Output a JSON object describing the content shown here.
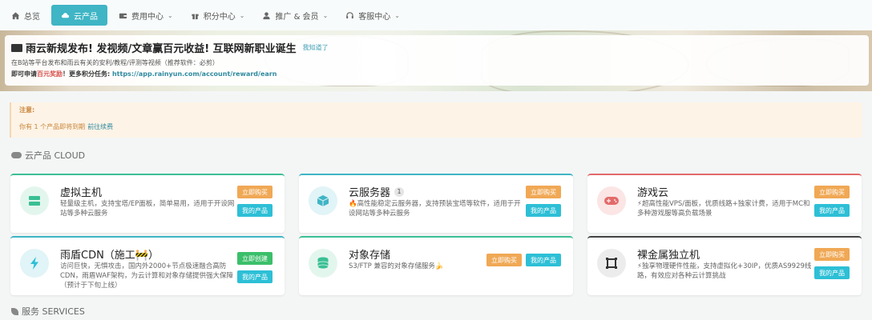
{
  "nav": {
    "items": [
      {
        "label": "总览",
        "icon": "home-icon"
      },
      {
        "label": "云产品",
        "icon": "cloud-icon"
      },
      {
        "label": "费用中心",
        "icon": "wallet-icon"
      },
      {
        "label": "积分中心",
        "icon": "gift-icon"
      },
      {
        "label": "推广 & 会员",
        "icon": "user-icon"
      },
      {
        "label": "客服中心",
        "icon": "headset-icon"
      }
    ],
    "active_color": "#3fb5c5"
  },
  "notice": {
    "title": "雨云新规发布! 发视频/文章赢百元收益! 互联网新职业诞生",
    "know_link": "我知道了",
    "line1": "在B站等平台发布和雨云有关的安利/教程/评测等视频（推荐软件：必剪）",
    "line2_prefix": "即可申请",
    "line2_red": "百元奖励",
    "line2_mid": "！更多积分任务: ",
    "line2_link": "https://app.rainyun.com/account/reward/earn"
  },
  "alert": {
    "title": "注意:",
    "body": "你有 1 个产品即将到期",
    "link": "前往续费"
  },
  "sections": {
    "cloud": "云产品 CLOUD",
    "services": "服务 SERVICES"
  },
  "products": [
    {
      "title": "虚拟主机",
      "desc": "轻量级主机，支持宝塔/EP面板，简单易用，适用于开设网站等多种云服务",
      "btn1": "立即购买",
      "btn2": "我的产品",
      "icon": "server-icon",
      "color": "#3bbf94"
    },
    {
      "title": "云服务器",
      "badge": "1",
      "desc": "🔥高性能稳定云服务器，支持预装宝塔等软件，适用于开设网站等多种云服务",
      "btn1": "立即购买",
      "btn2": "我的产品",
      "icon": "box-icon",
      "color": "#3fb5c5"
    },
    {
      "title": "游戏云",
      "desc": "⚡超高性能VPS/面板，优质线路+独家计费，适用于MC和多种游戏服等高负载场景",
      "btn1": "立即购买",
      "btn2": "我的产品",
      "icon": "gamepad-icon",
      "color": "#e36a6a"
    },
    {
      "title": "雨盾CDN（施工🚧）",
      "desc": "访问巨快，无惧攻击，国内外2000+节点极速融合高防CDN，雨盾WAF架构，为云计算和对象存储提供强大保障（预计于下旬上线）",
      "btn1": "立即创建",
      "btn2": "我的产品",
      "icon": "bolt-icon",
      "color": "#3fb5c5"
    },
    {
      "title": "对象存储",
      "desc": "S3/FTP 兼容的对象存储服务🍌",
      "btn1": "立即购买",
      "btn2": "我的产品",
      "icon": "database-icon",
      "color": "#3bbf94"
    },
    {
      "title": "裸金属独立机",
      "desc": "⚡独享物理硬件性能，支持虚拟化+30IP，优质AS9929线路，有效应对各种云计算挑战",
      "btn1": "立即购买",
      "btn2": "我的产品",
      "icon": "chip-icon",
      "color": "#444444"
    }
  ]
}
